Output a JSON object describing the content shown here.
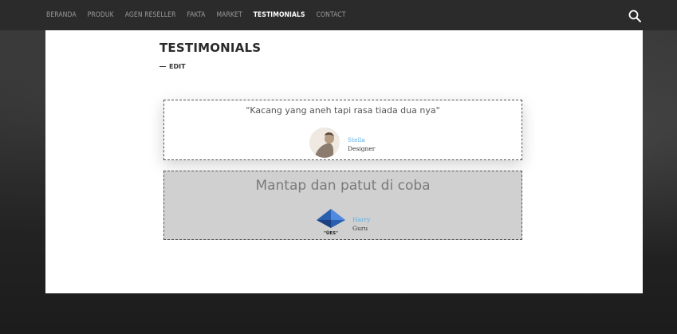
{
  "nav": {
    "items": [
      {
        "label": "BERANDA",
        "active": false
      },
      {
        "label": "PRODUK",
        "active": false
      },
      {
        "label": "AGEN RESELLER",
        "active": false
      },
      {
        "label": "FAKTA",
        "active": false
      },
      {
        "label": "MARKET",
        "active": false
      },
      {
        "label": "TESTIMONIALS",
        "active": true
      },
      {
        "label": "CONTACT",
        "active": false
      }
    ],
    "search_icon": "search-icon"
  },
  "page": {
    "title": "TESTIMONIALS",
    "edit_label": "EDIT"
  },
  "testimonials": [
    {
      "quote": "\"Kacang yang aneh tapi rasa tiada dua nya\"",
      "name": "Stella",
      "role": "Designer"
    },
    {
      "quote": "Mantap dan patut di coba",
      "name": "Harry",
      "role": "Guru",
      "logo_text": "\"ÜES\""
    }
  ],
  "colors": {
    "nav_bg": "#2b2b2b",
    "nav_text": "#9a9a9a",
    "nav_active": "#ffffff",
    "name_accent": "#5ab0e8",
    "card_2_bg": "#d0d0d0"
  }
}
